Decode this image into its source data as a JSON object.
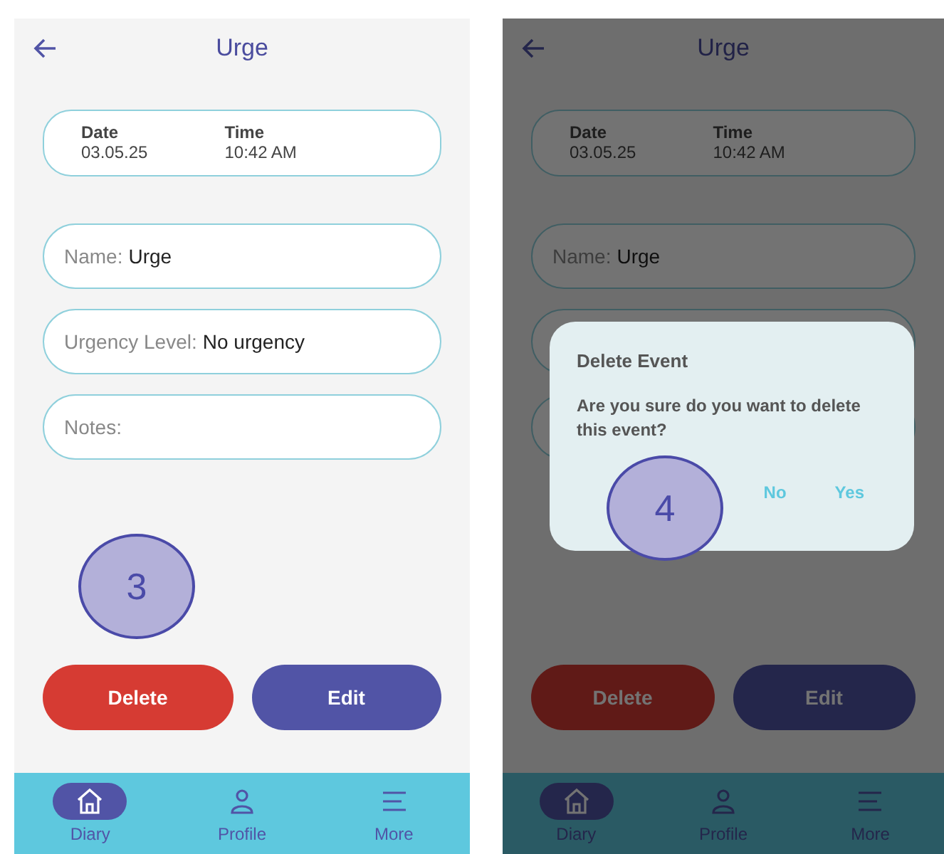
{
  "screens": [
    {
      "title": "Urge",
      "dimmed": false,
      "info": [
        {
          "label": "Date",
          "value": "03.05.25"
        },
        {
          "label": "Time",
          "value": "10:42 AM"
        }
      ],
      "fields": [
        {
          "label": "Name:",
          "value": "Urge"
        },
        {
          "label": "Urgency Level:",
          "value": "No urgency"
        },
        {
          "label": "Notes:"
        }
      ],
      "buttons": [
        {
          "kind": "delete",
          "label": "Delete"
        },
        {
          "kind": "edit",
          "label": "Edit"
        }
      ],
      "nav": [
        {
          "kind": "home",
          "label": "Diary",
          "selected": true
        },
        {
          "kind": "person",
          "label": "Profile",
          "selected": false
        },
        {
          "kind": "menu",
          "label": "More",
          "selected": false
        }
      ],
      "callout": "3"
    },
    {
      "title": "Urge",
      "dimmed": true,
      "info": [
        {
          "label": "Date",
          "value": "03.05.25"
        },
        {
          "label": "Time",
          "value": "10:42 AM"
        }
      ],
      "fields": [
        {
          "kind": "text",
          "label": "Name:",
          "value": "Urge"
        },
        {
          "kind": "covered"
        },
        {
          "kind": "covered"
        }
      ],
      "buttons": [
        {
          "kind": "delete",
          "label": "Delete"
        },
        {
          "kind": "edit",
          "label": "Edit"
        }
      ],
      "nav": [
        {
          "kind": "home",
          "label": "Diary",
          "selected": true
        },
        {
          "kind": "person",
          "label": "Profile",
          "selected": false
        },
        {
          "kind": "menu",
          "label": "More",
          "selected": false
        }
      ],
      "dialog": {
        "title": "Delete Event",
        "message": "Are you sure do you want to delete this event?",
        "actions": [
          "No",
          "Yes"
        ]
      },
      "callout": "4"
    }
  ]
}
